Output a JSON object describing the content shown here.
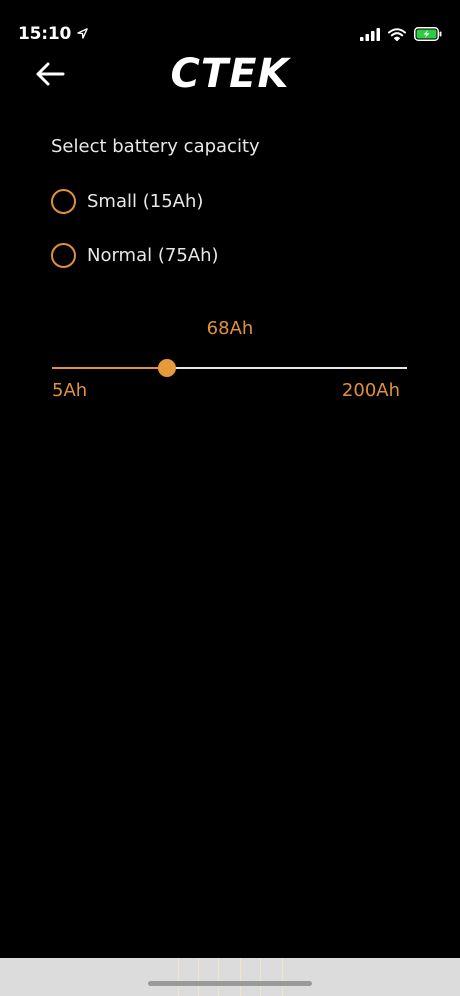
{
  "status_bar": {
    "time": "15:10",
    "location_icon": "location-arrow-icon",
    "signal_icon": "cellular-signal-icon",
    "wifi_icon": "wifi-icon",
    "battery_icon": "battery-charging-icon",
    "battery_color": "#2ecc40"
  },
  "header": {
    "back_icon": "arrow-left-icon",
    "logo_text": "CTEK"
  },
  "capacity": {
    "title": "Select battery capacity",
    "options": [
      {
        "label": "Small (15Ah)",
        "selected": false
      },
      {
        "label": "Normal (75Ah)",
        "selected": false
      }
    ]
  },
  "slider": {
    "value_label": "68Ah",
    "value": 68,
    "min": 5,
    "max": 200,
    "min_label": "5Ah",
    "max_label": "200Ah"
  },
  "colors": {
    "accent": "#e0913b",
    "background": "#000000",
    "text": "#e8e8e8"
  }
}
